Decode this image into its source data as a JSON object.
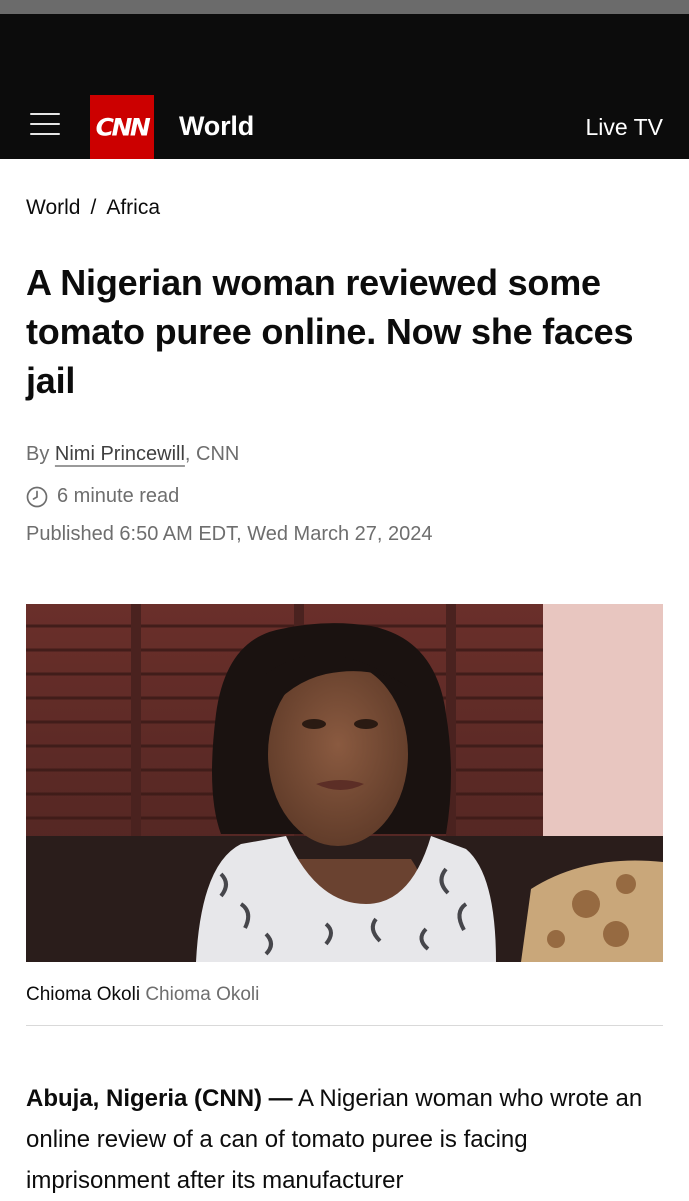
{
  "header": {
    "section_title": "World",
    "logo_text": "CNN",
    "live_tv": "Live TV",
    "brand_color": "#cc0000"
  },
  "breadcrumb": {
    "items": [
      "World",
      "Africa"
    ],
    "separator": "/"
  },
  "article": {
    "headline": "A Nigerian woman reviewed some tomato puree online. Now she faces jail",
    "byline_prefix": "By ",
    "author": "Nimi Princewill",
    "byline_suffix": ", CNN",
    "read_time": "6 minute read",
    "published": "Published 6:50 AM EDT, Wed March 27, 2024",
    "image_caption": "Chioma Okoli",
    "image_credit": "Chioma Okoli",
    "dateline": "Abuja, Nigeria (CNN) —",
    "body_start": " A Nigerian woman who wrote an online review of a can of tomato puree is facing imprisonment after its manufacturer"
  },
  "icons": {
    "menu": "hamburger-menu-icon",
    "clock": "clock-icon"
  }
}
